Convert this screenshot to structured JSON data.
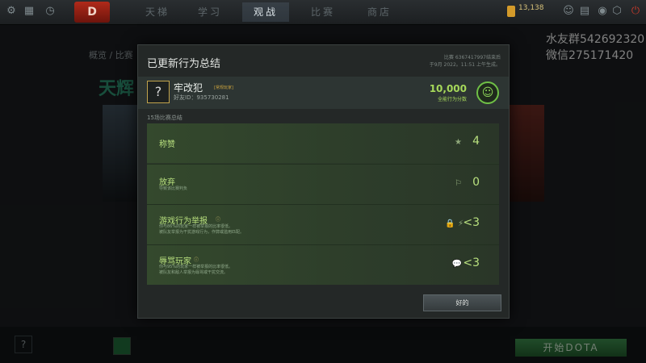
{
  "topbar": {
    "logo_text": "D",
    "tabs": [
      "天梯",
      "学习",
      "观战",
      "比赛",
      "商店"
    ],
    "active_tab": "观战",
    "gold_value": "13,138",
    "gold_sub": "",
    "icons": [
      "settings-icon",
      "grid-icon",
      "clock-icon",
      "shield-icon",
      "power-icon"
    ]
  },
  "watermark": {
    "line1": "水友群542692320",
    "line2": "微信275171420"
  },
  "background": {
    "crumb": "概览 / 比赛",
    "side_title": "天辉",
    "play_button": "开始DOTA",
    "help_glyph": "?"
  },
  "modal": {
    "title": "已更新行为总结",
    "match_info_line1": "比赛 6367417997结束后",
    "match_info_line2": "于9月 2022。11:51 上午生成。",
    "player": {
      "avatar_glyph": "?",
      "name": "牢改犯",
      "tag": "[常规玩家]",
      "friend_id_label": "好友ID：",
      "friend_id": "935730281",
      "score": "10,000",
      "score_label": "全能行为分数"
    },
    "summary_label": "15场比赛总结",
    "rows": [
      {
        "title": "称赞",
        "desc": "",
        "value": "4",
        "icon": "★",
        "info": ""
      },
      {
        "title": "放弃",
        "desc": "导致该比赛判负",
        "value": "0",
        "icon": "⚐",
        "info": ""
      },
      {
        "title": "游戏行为举报",
        "desc_line1": "你与86%的玩家一样被举报的比率很低。",
        "desc_line2": "被队友举报为干扰游戏行为，作弊或滥用匹配。",
        "value": "<3",
        "icon": "🔒 ⚡",
        "info": "ⓘ"
      },
      {
        "title": "辱骂玩家",
        "desc_line1": "你与95%的玩家一样被举报的比率很低。",
        "desc_line2": "被队友和敌人举报为辱骂或干扰交流。",
        "value": "<3",
        "icon": "💬",
        "info": "ⓘ"
      }
    ],
    "ok_button": "好的"
  }
}
